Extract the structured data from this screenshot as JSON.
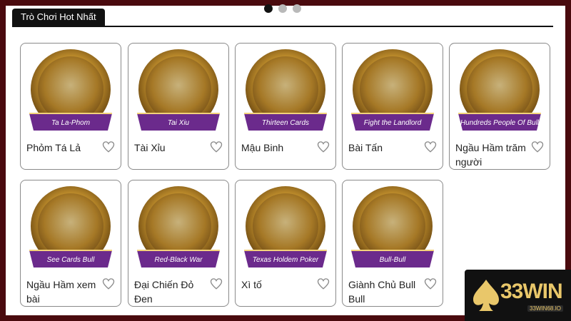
{
  "section": {
    "title": "Trò Chơi Hot Nhất"
  },
  "carousel": {
    "page_count": 3,
    "active_page": 1
  },
  "games": [
    {
      "name": "Phỏm Tá Lả",
      "banner": "Ta La-Phom",
      "accent": "#6b2a8c"
    },
    {
      "name": "Tài Xỉu",
      "banner": "Tai Xiu",
      "accent": "#6b2a8c"
    },
    {
      "name": "Mậu Binh",
      "banner": "Thirteen Cards",
      "accent": "#6b2a8c"
    },
    {
      "name": "Bài Tấn",
      "banner": "Fight the Landlord",
      "accent": "#6b2a8c"
    },
    {
      "name": "Ngầu Hầm trăm người",
      "banner": "Hundreds People Of Bull",
      "accent": "#6b2a8c"
    },
    {
      "name": "Ngầu Hầm xem bài",
      "banner": "See Cards Bull",
      "accent": "#6b2a8c"
    },
    {
      "name": "Đại Chiến Đỏ Đen",
      "banner": "Red-Black War",
      "accent": "#6b2a8c"
    },
    {
      "name": "Xì tố",
      "banner": "Texas Holdem Poker",
      "accent": "#6b2a8c"
    },
    {
      "name": "Giành Chủ Bull Bull",
      "banner": "Bull-Bull",
      "accent": "#6b2a8c"
    }
  ],
  "brand": {
    "logo_text": "33WIN",
    "logo_sub": "33WIN68.IO",
    "color": "#e9c76a"
  }
}
